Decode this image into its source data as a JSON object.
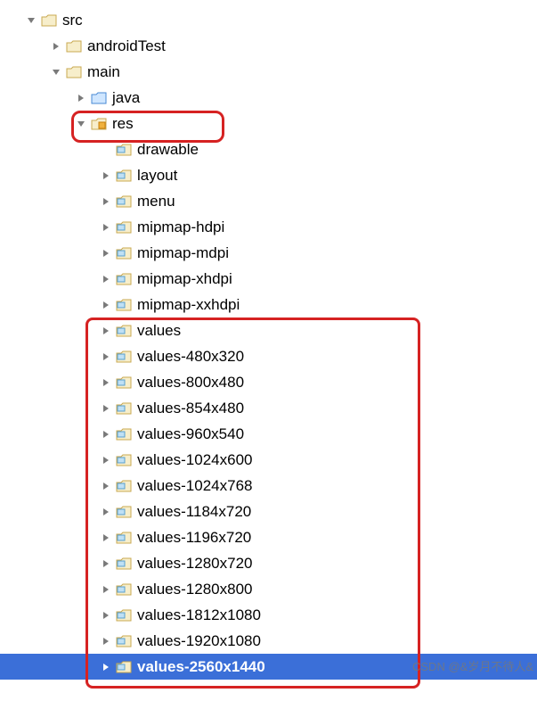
{
  "watermark": "CSDN @&岁月不待人&",
  "tree": [
    {
      "indent": 0,
      "arrow": "down",
      "icon": "folder",
      "label": "src",
      "sel": false
    },
    {
      "indent": 1,
      "arrow": "right",
      "icon": "folder",
      "label": "androidTest",
      "sel": false
    },
    {
      "indent": 1,
      "arrow": "down",
      "icon": "folder",
      "label": "main",
      "sel": false
    },
    {
      "indent": 2,
      "arrow": "right",
      "icon": "folder-blue",
      "label": "java",
      "sel": false
    },
    {
      "indent": 2,
      "arrow": "down",
      "icon": "folder-res",
      "label": "res",
      "sel": false
    },
    {
      "indent": 3,
      "arrow": "none",
      "icon": "xml",
      "label": "drawable",
      "sel": false
    },
    {
      "indent": 3,
      "arrow": "right",
      "icon": "xml",
      "label": "layout",
      "sel": false
    },
    {
      "indent": 3,
      "arrow": "right",
      "icon": "xml",
      "label": "menu",
      "sel": false
    },
    {
      "indent": 3,
      "arrow": "right",
      "icon": "xml",
      "label": "mipmap-hdpi",
      "sel": false
    },
    {
      "indent": 3,
      "arrow": "right",
      "icon": "xml",
      "label": "mipmap-mdpi",
      "sel": false
    },
    {
      "indent": 3,
      "arrow": "right",
      "icon": "xml",
      "label": "mipmap-xhdpi",
      "sel": false
    },
    {
      "indent": 3,
      "arrow": "right",
      "icon": "xml",
      "label": "mipmap-xxhdpi",
      "sel": false
    },
    {
      "indent": 3,
      "arrow": "right",
      "icon": "xml",
      "label": "values",
      "sel": false
    },
    {
      "indent": 3,
      "arrow": "right",
      "icon": "xml",
      "label": "values-480x320",
      "sel": false
    },
    {
      "indent": 3,
      "arrow": "right",
      "icon": "xml",
      "label": "values-800x480",
      "sel": false
    },
    {
      "indent": 3,
      "arrow": "right",
      "icon": "xml",
      "label": "values-854x480",
      "sel": false
    },
    {
      "indent": 3,
      "arrow": "right",
      "icon": "xml",
      "label": "values-960x540",
      "sel": false
    },
    {
      "indent": 3,
      "arrow": "right",
      "icon": "xml",
      "label": "values-1024x600",
      "sel": false
    },
    {
      "indent": 3,
      "arrow": "right",
      "icon": "xml",
      "label": "values-1024x768",
      "sel": false
    },
    {
      "indent": 3,
      "arrow": "right",
      "icon": "xml",
      "label": "values-1184x720",
      "sel": false
    },
    {
      "indent": 3,
      "arrow": "right",
      "icon": "xml",
      "label": "values-1196x720",
      "sel": false
    },
    {
      "indent": 3,
      "arrow": "right",
      "icon": "xml",
      "label": "values-1280x720",
      "sel": false
    },
    {
      "indent": 3,
      "arrow": "right",
      "icon": "xml",
      "label": "values-1280x800",
      "sel": false
    },
    {
      "indent": 3,
      "arrow": "right",
      "icon": "xml",
      "label": "values-1812x1080",
      "sel": false
    },
    {
      "indent": 3,
      "arrow": "right",
      "icon": "xml",
      "label": "values-1920x1080",
      "sel": false
    },
    {
      "indent": 3,
      "arrow": "right",
      "icon": "xml-sel",
      "label": "values-2560x1440",
      "sel": true
    }
  ]
}
